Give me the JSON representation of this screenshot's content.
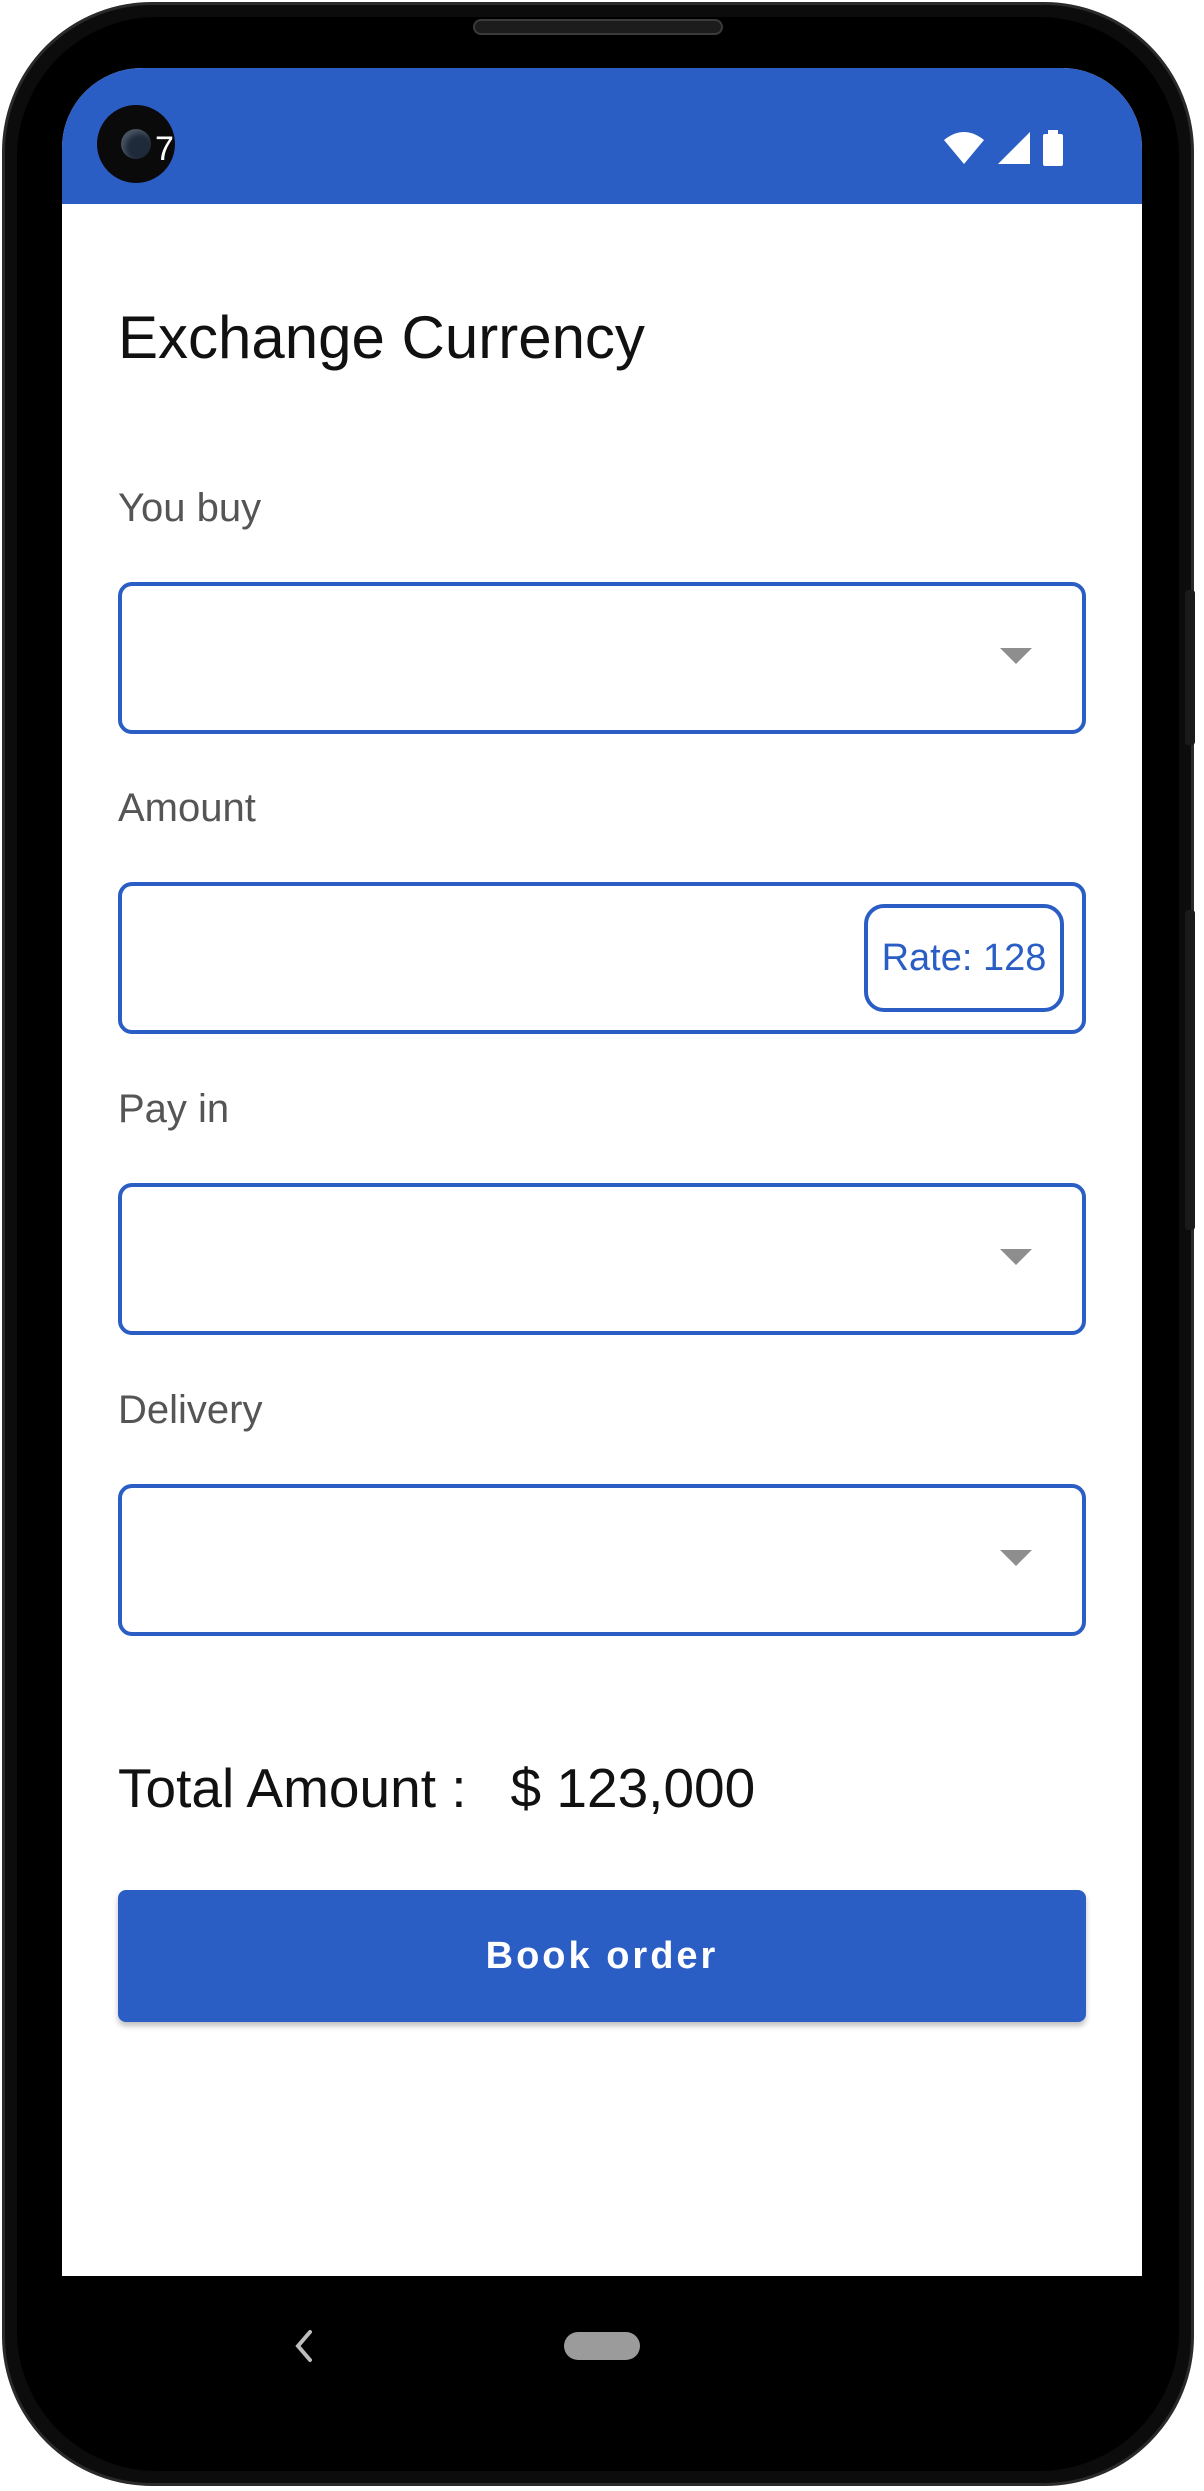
{
  "status_bar": {
    "time": "7",
    "color": "#2b5ec4",
    "icons": [
      "wifi-icon",
      "cellular-signal-icon",
      "battery-icon"
    ]
  },
  "page": {
    "title": "Exchange Currency"
  },
  "form": {
    "you_buy": {
      "label": "You buy",
      "value": "",
      "type": "dropdown"
    },
    "amount": {
      "label": "Amount",
      "value": "",
      "rate_label": "Rate: 128"
    },
    "pay_in": {
      "label": "Pay in",
      "value": "",
      "type": "dropdown"
    },
    "delivery": {
      "label": "Delivery",
      "value": "",
      "type": "dropdown"
    }
  },
  "summary": {
    "total_label": "Total Amount :",
    "total_value": "$ 123,000"
  },
  "actions": {
    "book_order_label": "Book order"
  },
  "nav_bar": {
    "icons": [
      "back-icon",
      "home-icon"
    ]
  },
  "theme": {
    "accent": "#2b5ec4",
    "label_text": "#555555",
    "dropdown_arrow": "#8e8e8e"
  }
}
